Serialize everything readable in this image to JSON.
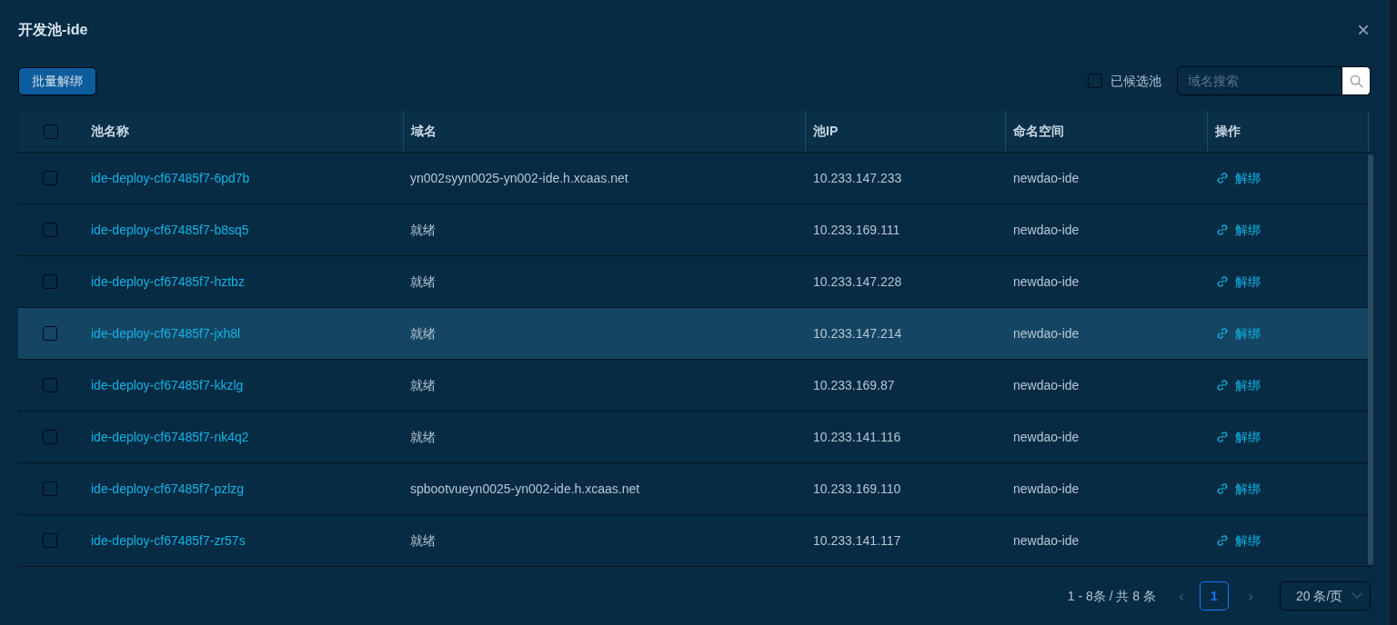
{
  "dialog": {
    "title": "开发池-ide",
    "close": "×"
  },
  "toolbar": {
    "batch_button": "批量解绑",
    "filter": {
      "label": "已候选池",
      "checked": false
    },
    "search": {
      "placeholder": "域名搜索"
    }
  },
  "table": {
    "select_all_checked": false,
    "columns": [
      "池名称",
      "域名",
      "池IP",
      "命名空间",
      "操作"
    ],
    "rows": [
      {
        "name": "ide-deploy-cf67485f7-6pd7b",
        "domain": "yn002syyn0025-yn002-ide.h.xcaas.net",
        "ip": "10.233.147.233",
        "namespace": "newdao-ide",
        "action": "解绑",
        "checked": false,
        "highlighted": false
      },
      {
        "name": "ide-deploy-cf67485f7-b8sq5",
        "domain": "就绪",
        "ip": "10.233.169.111",
        "namespace": "newdao-ide",
        "action": "解绑",
        "checked": false,
        "highlighted": false
      },
      {
        "name": "ide-deploy-cf67485f7-hztbz",
        "domain": "就绪",
        "ip": "10.233.147.228",
        "namespace": "newdao-ide",
        "action": "解绑",
        "checked": false,
        "highlighted": false
      },
      {
        "name": "ide-deploy-cf67485f7-jxh8l",
        "domain": "就绪",
        "ip": "10.233.147.214",
        "namespace": "newdao-ide",
        "action": "解绑",
        "checked": false,
        "highlighted": true
      },
      {
        "name": "ide-deploy-cf67485f7-kkzlg",
        "domain": "就绪",
        "ip": "10.233.169.87",
        "namespace": "newdao-ide",
        "action": "解绑",
        "checked": false,
        "highlighted": false
      },
      {
        "name": "ide-deploy-cf67485f7-nk4q2",
        "domain": "就绪",
        "ip": "10.233.141.116",
        "namespace": "newdao-ide",
        "action": "解绑",
        "checked": false,
        "highlighted": false
      },
      {
        "name": "ide-deploy-cf67485f7-pzlzg",
        "domain": "spbootvueyn0025-yn002-ide.h.xcaas.net",
        "ip": "10.233.169.110",
        "namespace": "newdao-ide",
        "action": "解绑",
        "checked": false,
        "highlighted": false
      },
      {
        "name": "ide-deploy-cf67485f7-zr57s",
        "domain": "就绪",
        "ip": "10.233.141.117",
        "namespace": "newdao-ide",
        "action": "解绑",
        "checked": false,
        "highlighted": false
      }
    ]
  },
  "pagination": {
    "summary": "1 - 8条 / 共 8 条",
    "prev": "‹",
    "pages": [
      {
        "label": "1",
        "selected": true
      }
    ],
    "next": "›",
    "page_size": "20 条/页"
  }
}
